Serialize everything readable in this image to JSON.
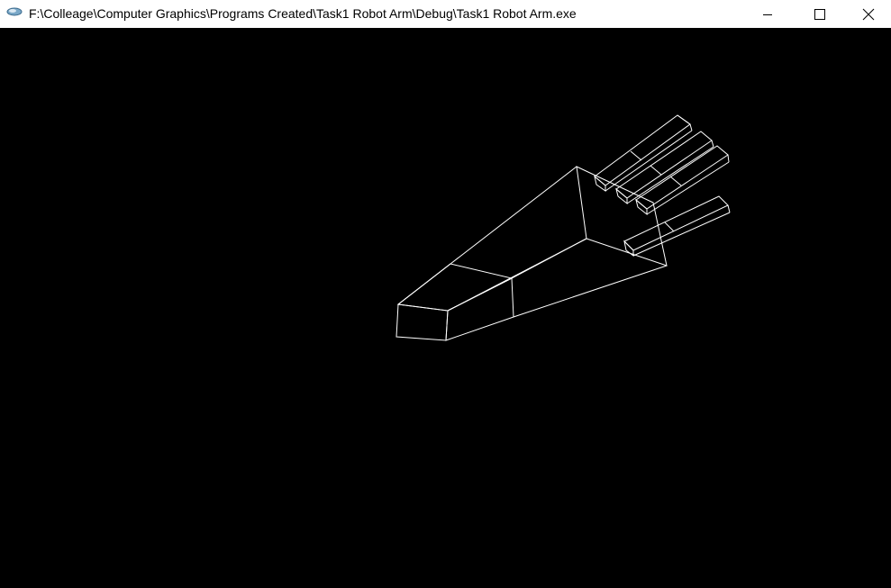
{
  "window": {
    "title": "F:\\Colleage\\Computer Graphics\\Programs Created\\Task1 Robot Arm\\Debug\\Task1 Robot Arm.exe",
    "icon": "app-icon",
    "controls": {
      "minimize_icon": "minimize-icon",
      "maximize_icon": "maximize-icon",
      "close_icon": "close-icon"
    }
  },
  "canvas": {
    "background": "#000000",
    "wire_color": "#ffffff",
    "scene": "wireframe-robot-arm"
  }
}
